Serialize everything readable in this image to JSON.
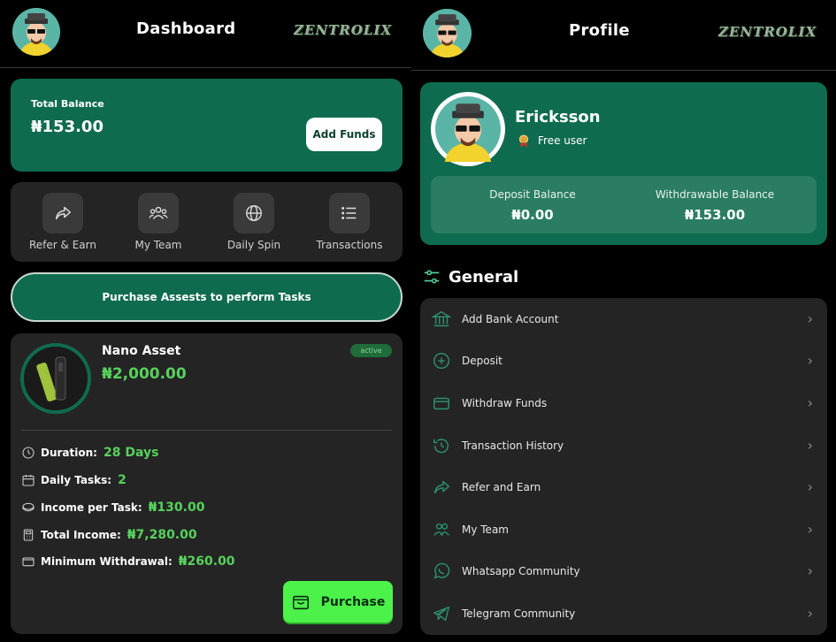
{
  "left": {
    "header": {
      "title": "Dashboard",
      "brand": "ZENTROLIX"
    },
    "balance": {
      "label": "Total Balance",
      "amount": "₦153.00",
      "add_funds": "Add Funds"
    },
    "actions": [
      {
        "label": "Refer & Earn",
        "icon": "share-icon"
      },
      {
        "label": "My Team",
        "icon": "team-icon"
      },
      {
        "label": "Daily Spin",
        "icon": "globe-icon"
      },
      {
        "label": "Transactions",
        "icon": "list-icon"
      }
    ],
    "purchase_banner": "Purchase Assests to perform Tasks",
    "asset": {
      "name": "Nano Asset",
      "price": "₦2,000.00",
      "status": "active",
      "stats": [
        {
          "label": "Duration:",
          "value": "28 Days",
          "icon": "clock-icon"
        },
        {
          "label": "Daily Tasks:",
          "value": "2",
          "icon": "calendar-icon"
        },
        {
          "label": "Income per Task:",
          "value": "₦130.00",
          "icon": "coin-icon"
        },
        {
          "label": "Total Income:",
          "value": "₦7,280.00",
          "icon": "calculator-icon"
        },
        {
          "label": "Minimum Withdrawal:",
          "value": "₦260.00",
          "icon": "wallet-icon"
        }
      ],
      "purchase": "Purchase"
    }
  },
  "right": {
    "header": {
      "title": "Profile",
      "brand": "ZENTROLIX"
    },
    "profile": {
      "name": "Ericksson",
      "role": "Free user",
      "deposit_label": "Deposit Balance",
      "deposit_value": "₦0.00",
      "withdraw_label": "Withdrawable Balance",
      "withdraw_value": "₦153.00"
    },
    "section_title": "General",
    "menu": [
      {
        "label": "Add Bank Account",
        "icon": "bank-icon"
      },
      {
        "label": "Deposit",
        "icon": "plus-circle-icon"
      },
      {
        "label": "Withdraw Funds",
        "icon": "card-icon"
      },
      {
        "label": "Transaction History",
        "icon": "history-icon"
      },
      {
        "label": "Refer and Earn",
        "icon": "share-icon"
      },
      {
        "label": "My Team",
        "icon": "team-icon"
      },
      {
        "label": "Whatsapp Community",
        "icon": "whatsapp-icon"
      },
      {
        "label": "Telegram Community",
        "icon": "telegram-icon"
      }
    ]
  },
  "colors": {
    "accent_green": "#0f6b4f",
    "bright_green": "#57d15b",
    "button_green": "#4cf24a",
    "card_dark": "#242424"
  }
}
